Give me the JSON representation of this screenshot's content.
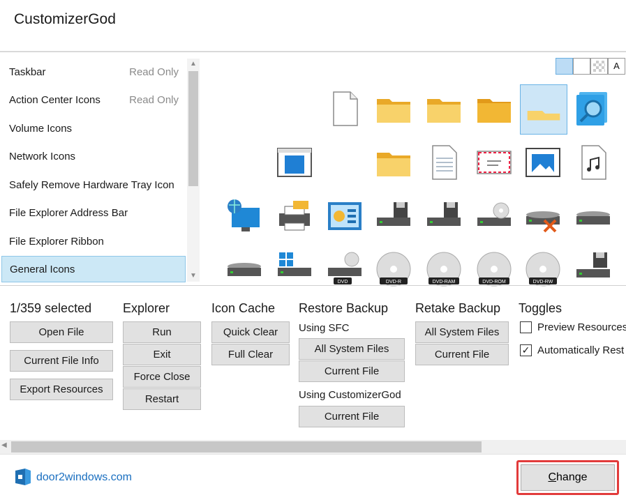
{
  "app": {
    "title": "CustomizerGod"
  },
  "list": {
    "items": [
      {
        "label": "Taskbar",
        "status": "Read Only"
      },
      {
        "label": "Action Center Icons",
        "status": "Read Only"
      },
      {
        "label": "Volume Icons",
        "status": ""
      },
      {
        "label": "Network Icons",
        "status": ""
      },
      {
        "label": "Safely Remove Hardware Tray Icon",
        "status": ""
      },
      {
        "label": "File Explorer Address Bar",
        "status": ""
      },
      {
        "label": "File Explorer Ribbon",
        "status": ""
      },
      {
        "label": "General Icons",
        "status": ""
      }
    ],
    "selected": "General Icons"
  },
  "view_buttons": {
    "text_mode": "A"
  },
  "icon_badges": [
    "DVD",
    "DVD-R",
    "DVD-RAM",
    "DVD-ROM",
    "DVD-RW"
  ],
  "selection": {
    "count_label": "1/359 selected"
  },
  "groups": {
    "file": {
      "buttons": [
        "Open File",
        "Current File Info",
        "Export Resources"
      ]
    },
    "explorer": {
      "title": "Explorer",
      "buttons": [
        "Run",
        "Exit",
        "Force Close",
        "Restart"
      ]
    },
    "icon_cache": {
      "title": "Icon Cache",
      "buttons": [
        "Quick Clear",
        "Full Clear"
      ]
    },
    "restore_backup": {
      "title": "Restore Backup",
      "sfc_label": "Using SFC",
      "sfc_buttons": [
        "All System Files",
        "Current File"
      ],
      "cg_label": "Using CustomizerGod",
      "cg_buttons": [
        "Current File"
      ]
    },
    "retake_backup": {
      "title": "Retake Backup",
      "buttons": [
        "All System Files",
        "Current File"
      ]
    },
    "toggles": {
      "title": "Toggles",
      "items": [
        {
          "label": "Preview Resources",
          "checked": false
        },
        {
          "label": "Automatically Rest",
          "checked": true
        }
      ]
    }
  },
  "footer": {
    "link": "door2windows.com",
    "change_mnemonic": "C",
    "change_rest": "hange"
  },
  "colors": {
    "selection_bg": "#cce8f6",
    "link": "#1a6fc0",
    "highlight_box": "#e23b3b",
    "folder": "#f6c344"
  }
}
